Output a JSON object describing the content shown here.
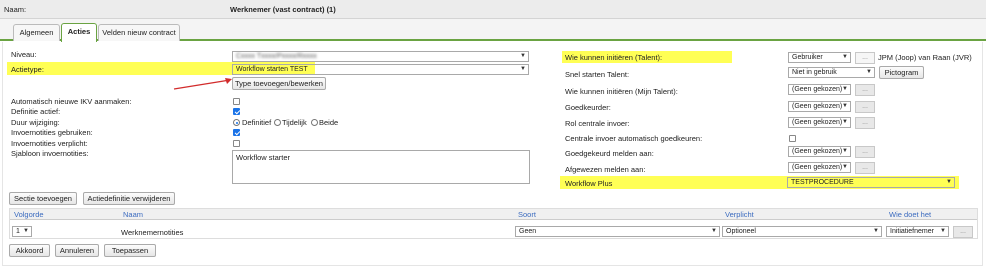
{
  "header": {
    "name_label": "Naam:",
    "title": "Werknemer (vast contract) (1)"
  },
  "tabs": [
    "Algemeen",
    "Acties",
    "Velden nieuw contract"
  ],
  "left": {
    "niveau_label": "Niveau:",
    "niveau_value": "Cxxxx Txxxx/Pxxxx/Rxxxx",
    "actietype_label": "Actietype:",
    "actietype_value": "Workflow starten TEST",
    "type_button": "Type toevoegen/bewerken",
    "auto_ikv_label": "Automatisch nieuwe IKV aanmaken:",
    "definitie_label": "Definitie actief:",
    "duur_label": "Duur wijziging:",
    "duur_options": [
      "Definitief",
      "Tijdelijk",
      "Beide"
    ],
    "invoernotities_label": "Invoernotities gebruiken:",
    "invoernotities_verplicht_label": "Invoernotities verplicht:",
    "sjabloon_label": "Sjabloon invoernotities:",
    "sjabloon_value": "Workflow starter"
  },
  "right": {
    "wie_initieren_label": "Wie kunnen initiëren (Talent):",
    "wie_initieren_value": "Gebruiker",
    "wie_initieren_user": "JPM (Joop) van Raan (JVR)",
    "snel_label": "Snel starten Talent:",
    "snel_value": "Niet in gebruik",
    "pictogram_button": "Pictogram",
    "wie_mijn_label": "Wie kunnen initiëren (Mijn Talent):",
    "wie_mijn_value": "(Geen gekozen)",
    "goedkeurder_label": "Goedkeurder:",
    "goedkeurder_value": "(Geen gekozen)",
    "rol_label": "Rol centrale invoer:",
    "rol_value": "(Geen gekozen)",
    "centrale_label": "Centrale invoer automatisch goedkeuren:",
    "goedgekeurd_label": "Goedgekeurd melden aan:",
    "goedgekeurd_value": "(Geen gekozen)",
    "afgewezen_label": "Afgewezen melden aan:",
    "afgewezen_value": "(Geen gekozen)",
    "workflow_label": "Workflow Plus",
    "workflow_value": "TESTPROCEDURE",
    "dots": "..."
  },
  "buttons": {
    "sectie": "Sectie toevoegen",
    "actiedef": "Actiedefinitie verwijderen",
    "akkoord": "Akkoord",
    "annuleren": "Annuleren",
    "toepassen": "Toepassen"
  },
  "table": {
    "headers": [
      "Volgorde",
      "Naam",
      "Soort",
      "Verplicht",
      "Wie doet het"
    ],
    "row": {
      "volgorde": "1",
      "naam": "Werknemernotities",
      "soort": "Geen",
      "verplicht": "Optioneel",
      "wie": "Initiatiefnemer"
    }
  },
  "colors": {
    "highlight": "#ffff55",
    "accent": "#6aa342",
    "arrow": "#d22b2b",
    "header_text": "#3b6bbf"
  }
}
